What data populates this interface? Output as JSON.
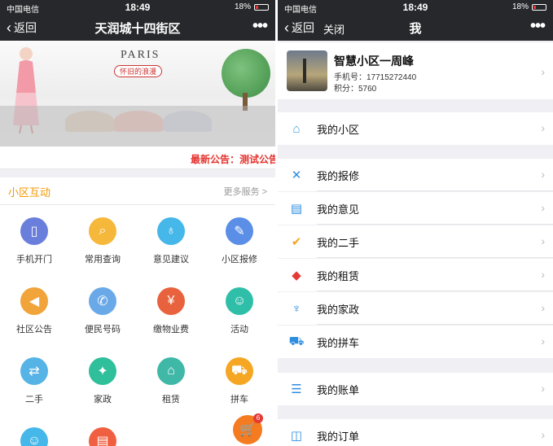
{
  "left": {
    "status": {
      "carrier": "中国电信",
      "time": "18:49",
      "battery": "18%"
    },
    "nav": {
      "back": "返回",
      "title": "天润城十四街区",
      "more": "•••"
    },
    "banner": {
      "brand": "PARIS",
      "tagline": "怀旧的浪漫"
    },
    "notice": "最新公告：测试公告",
    "section": {
      "title": "小区互动",
      "more": "更多服务 >"
    },
    "services": [
      {
        "label": "手机开门",
        "icon": "door-icon",
        "color": "#6a7fdb",
        "glyph": "▯"
      },
      {
        "label": "常用查询",
        "icon": "search-icon",
        "color": "#f5b83a",
        "glyph": "⌕"
      },
      {
        "label": "意见建议",
        "icon": "lightbulb-icon",
        "color": "#45b7e8",
        "glyph": "♁"
      },
      {
        "label": "小区报修",
        "icon": "wrench-icon",
        "color": "#5b8ee6",
        "glyph": "✎"
      },
      {
        "label": "社区公告",
        "icon": "megaphone-icon",
        "color": "#f0a43a",
        "glyph": "◀"
      },
      {
        "label": "便民号码",
        "icon": "phone-icon",
        "color": "#6aa9e8",
        "glyph": "✆"
      },
      {
        "label": "缴物业费",
        "icon": "ticket-icon",
        "color": "#e8623d",
        "glyph": "¥"
      },
      {
        "label": "活动",
        "icon": "activity-icon",
        "color": "#2fbfa9",
        "glyph": "☺"
      },
      {
        "label": "二手",
        "icon": "signpost-icon",
        "color": "#56b3e6",
        "glyph": "⇄"
      },
      {
        "label": "家政",
        "icon": "broom-icon",
        "color": "#2fbf9a",
        "glyph": "✦"
      },
      {
        "label": "租赁",
        "icon": "house-icon",
        "color": "#3fb8a8",
        "glyph": "⌂"
      },
      {
        "label": "拼车",
        "icon": "car-icon",
        "color": "#f5a623",
        "glyph": "⛟"
      },
      {
        "label": "",
        "icon": "group-icon",
        "color": "#45b7e8",
        "glyph": "☺"
      },
      {
        "label": "",
        "icon": "shop-icon",
        "color": "#f06040",
        "glyph": "▤"
      }
    ],
    "cart_badge": "6"
  },
  "right": {
    "status": {
      "carrier": "中国电信",
      "time": "18:49",
      "battery": "18%"
    },
    "nav": {
      "back": "返回",
      "close": "关闭",
      "title": "我",
      "more": "•••"
    },
    "profile": {
      "name": "智慧小区一周峰",
      "phone": "手机号：17715272440",
      "points": "积分：5760"
    },
    "groups": [
      [
        {
          "label": "我的小区",
          "icon": "house-outline-icon",
          "color": "#3aa0e0",
          "glyph": "⌂"
        }
      ],
      [
        {
          "label": "我的报修",
          "icon": "tools-icon",
          "color": "#2d8ee0",
          "glyph": "✕"
        },
        {
          "label": "我的意见",
          "icon": "notebook-icon",
          "color": "#2d8ee0",
          "glyph": "▤"
        },
        {
          "label": "我的二手",
          "icon": "exchange-icon",
          "color": "#f5a623",
          "glyph": "✔"
        },
        {
          "label": "我的租赁",
          "icon": "stack-icon",
          "color": "#e53935",
          "glyph": "◆"
        },
        {
          "label": "我的家政",
          "icon": "broom-icon",
          "color": "#2d8ee0",
          "glyph": "♆"
        },
        {
          "label": "我的拼车",
          "icon": "car-icon",
          "color": "#2d8ee0",
          "glyph": "⛟"
        }
      ],
      [
        {
          "label": "我的账单",
          "icon": "bill-icon",
          "color": "#2d8ee0",
          "glyph": "☰"
        }
      ],
      [
        {
          "label": "我的订单",
          "icon": "bag-icon",
          "color": "#2d8ee0",
          "glyph": "◫"
        }
      ]
    ]
  }
}
